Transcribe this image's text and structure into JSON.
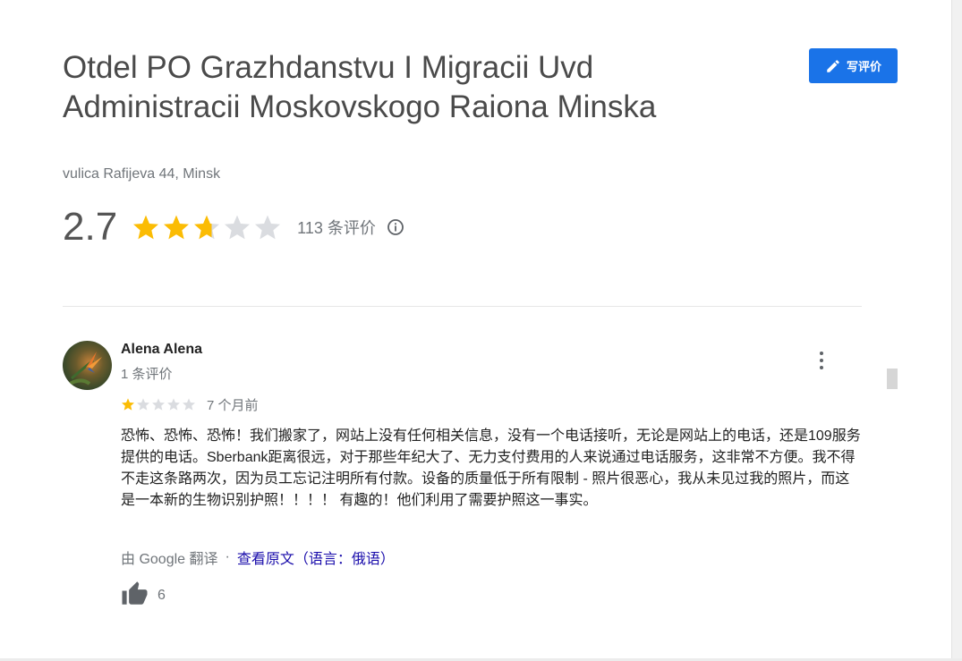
{
  "place": {
    "title": "Otdel PO Grazhdanstvu I Migracii Uvd Administracii Moskovskogo Raiona Minska",
    "address": "vulica Rafijeva 44, Minsk"
  },
  "write_review": {
    "label": "写评价",
    "icon": "pencil-icon"
  },
  "rating": {
    "value": "2.7",
    "stars_filled": 2.7,
    "stars_total": 5,
    "count_label": "113 条评价",
    "info_icon": "info-icon"
  },
  "review": {
    "author": "Alena Alena",
    "author_meta": "1 条评价",
    "stars": 1,
    "time": "7 个月前",
    "text": "恐怖、恐怖、恐怖！我们搬家了，网站上没有任何相关信息，没有一个电话接听，无论是网站上的电话，还是109服务提供的电话。Sberbank距离很远，对于那些年纪大了、无力支付费用的人来说通过电话服务，这非常不方便。我不得不走这条路两次，因为员工忘记注明所有付款。设备的质量低于所有限制 - 照片很恶心，我从未见过我的照片，而这是一本新的生物识别护照！！！！ 有趣的！他们利用了需要护照这一事实。",
    "translated_by": "由 Google 翻译",
    "separator": "·",
    "see_original": "查看原文（语言：俄语）",
    "likes": "6",
    "like_icon": "thumbs-up-icon",
    "more_icon": "more-vert-icon"
  },
  "colors": {
    "accent": "#1a73e8",
    "star_filled": "#fbbc04",
    "star_empty": "#dadce0",
    "link": "#1a0dab"
  }
}
